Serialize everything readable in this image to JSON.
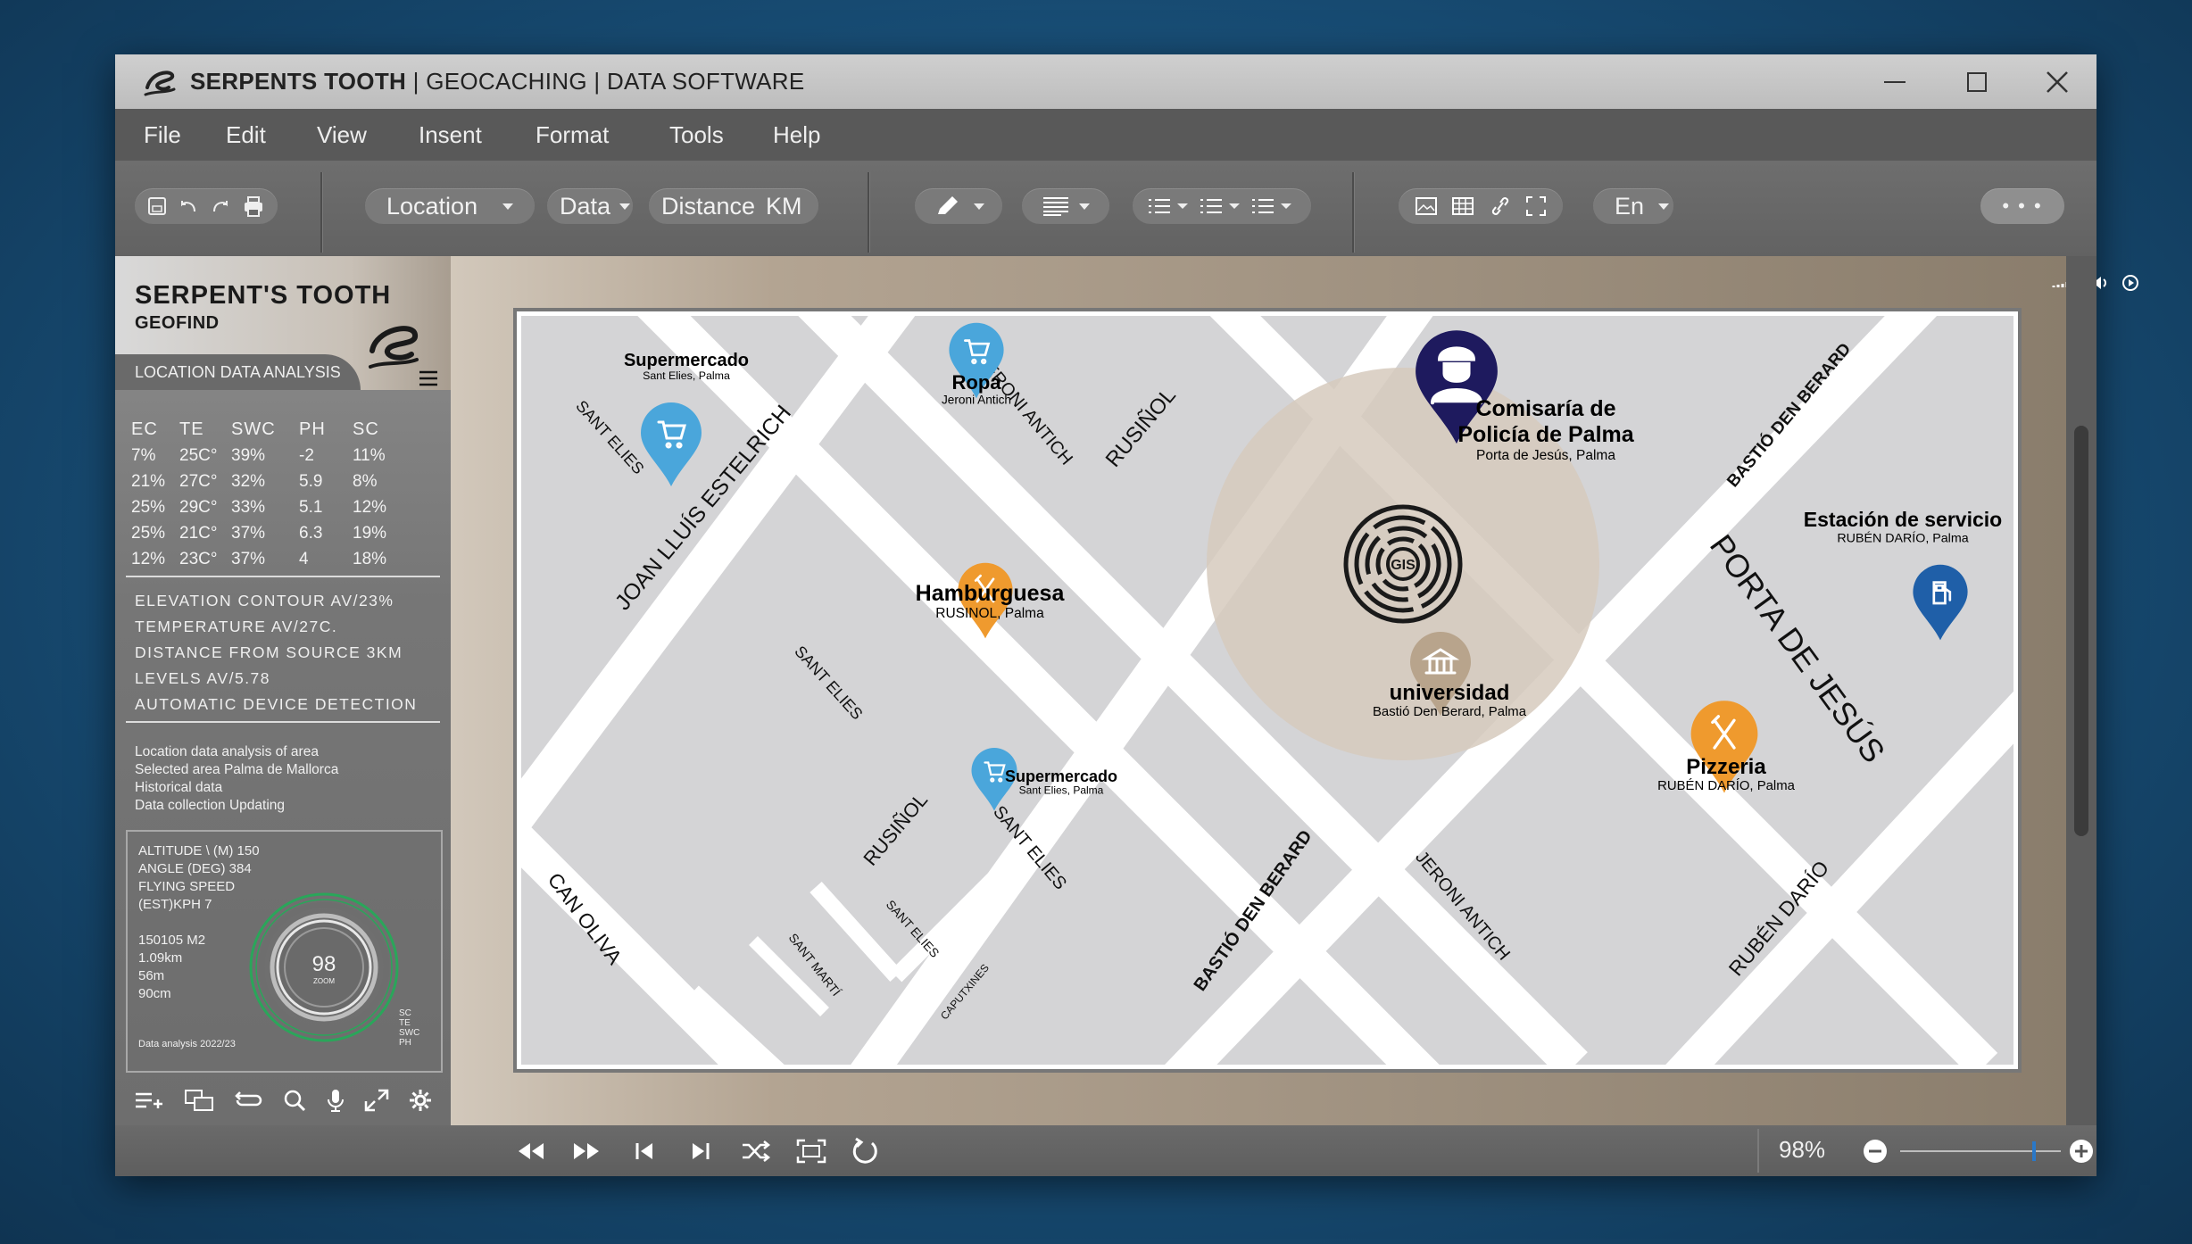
{
  "titlebar": {
    "brand": "SERPENTS TOOTH",
    "rest": " | GEOCACHING | DATA SOFTWARE"
  },
  "menu": [
    "File",
    "Edit",
    "View",
    "Insent",
    "Format",
    "Tools",
    "Help"
  ],
  "toolbar": {
    "location": "Location",
    "data": "Data",
    "distance": "Distance",
    "unit": "KM",
    "language": "En",
    "more": "• • •"
  },
  "sidebar": {
    "brand": "SERPENT'S TOOTH",
    "sub": "GEOFIND",
    "band": "LOCATION DATA ANALYSIS",
    "headers": [
      "EC",
      "TE",
      "SWC",
      "PH",
      "SC"
    ],
    "rows": [
      [
        "7%",
        "25C°",
        "39%",
        "-2",
        "11%"
      ],
      [
        "21%",
        "27C°",
        "32%",
        "5.9",
        "8%"
      ],
      [
        "25%",
        "29C°",
        "33%",
        "5.1",
        "12%"
      ],
      [
        "25%",
        "21C°",
        "37%",
        "6.3",
        "19%"
      ],
      [
        "12%",
        "23C°",
        "37%",
        "4",
        "18%"
      ]
    ],
    "stats": [
      "ELEVATION CONTOUR AV/23%",
      "TEMPERATURE  AV/27C.",
      "DISTANCE FROM SOURCE 3KM",
      "LEVELS AV/5.78",
      "AUTOMATIC DEVICE DETECTION"
    ],
    "notes": [
      "Location data analysis of area",
      "Selected area Palma de Mallorca",
      "Historical data",
      "Data collection Updating"
    ],
    "altitude": [
      "ALTITUDE \\ (M) 150",
      "ANGLE (DEG) 384",
      "FLYING SPEED",
      "(EST)KPH 7"
    ],
    "measures": [
      "150105 M2",
      "1.09km",
      "56m",
      "90cm"
    ],
    "gauge_value": "98",
    "gauge_label": "ZOOM",
    "footnote": "Data analysis 2022/23",
    "legend_small": [
      "SC",
      "TE",
      "SWC",
      "PH"
    ]
  },
  "map": {
    "streets": [
      "SANT ELIES",
      "JOAN LLUÍS ESTELRICH",
      "JERONI ANTICH",
      "RUSIÑOL",
      "BASTIÓ DEN BERARD",
      "PORTA DE JESÚS",
      "SANT ELIES",
      "RUSIÑOL",
      "SANT ELIES",
      "CAN OLIVA",
      "SANT ELIES",
      "SANT MARTÍ",
      "CAPUTXINES",
      "BASTIÓ DEN BERARD",
      "JERONI ANTICH",
      "RUBÉN DARÍO"
    ],
    "places": [
      {
        "name": "Supermercado",
        "sub": "Sant Elies, Palma"
      },
      {
        "name": "Ropa",
        "sub": "Jeroni Antich"
      },
      {
        "name": "Comisaría de",
        "name2": "Policía de Palma",
        "sub": "Porta de Jesús, Palma"
      },
      {
        "name": "Estación de servicio",
        "sub": "RUBÉN DARÍO, Palma"
      },
      {
        "name": "Hamburguesa",
        "sub": "RUSINOL, Palma"
      },
      {
        "name": "universidad",
        "sub": "Bastió Den Berard, Palma"
      },
      {
        "name": "Pizzeria",
        "sub": "RUBÉN DARÍO, Palma"
      },
      {
        "name": "Supermercado",
        "sub": "Sant Elies, Palma"
      }
    ],
    "center_badge": "GIS"
  },
  "bottom": {
    "zoom": "98%",
    "zoom_level": 0.82
  },
  "colors": {
    "police": "#1e1a5e",
    "shop": "#4aa6db",
    "food": "#ef9a2e",
    "fuel": "#1f5fa8",
    "uni": "#b8a48c"
  }
}
